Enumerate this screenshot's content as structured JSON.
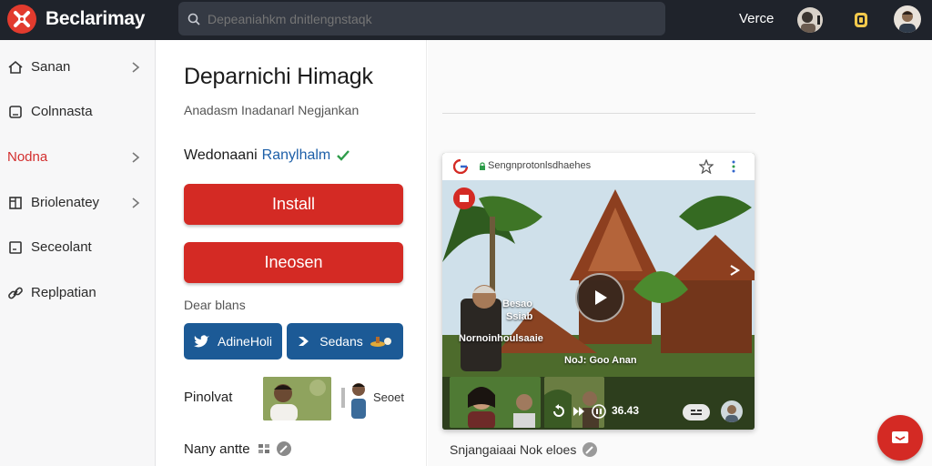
{
  "app": {
    "brand": "Beclarimay"
  },
  "search": {
    "placeholder": "Depeaniahkm dnitlengnstaqk"
  },
  "topbar": {
    "link": "Verce"
  },
  "sidebar": {
    "items": [
      {
        "label": "Sanan",
        "icon": "home-icon",
        "chevron": true
      },
      {
        "label": "Colnnasta",
        "icon": "square-icon",
        "chevron": false
      },
      {
        "label": "Nodna",
        "icon": "none",
        "chevron": true,
        "active": true
      },
      {
        "label": "Briolenatey",
        "icon": "columns-icon",
        "chevron": true
      },
      {
        "label": "Seceolant",
        "icon": "box-icon",
        "chevron": false
      },
      {
        "label": "Replpatian",
        "icon": "link-icon",
        "chevron": false
      }
    ]
  },
  "main": {
    "title": "Deparnichi Himagk",
    "subtitle": "Anadasm Inadanarl Negjankan",
    "developer_label": "Wedonaani",
    "developer_link": "Ranylhalm",
    "install_label": "Install",
    "secondary_label": "Ineosen",
    "share_label": "Dear blans",
    "share_twitter_label": "AdineHoli",
    "share_other_label": "Sedans",
    "profile_label": "Pinolvat",
    "profile_thumb_text": "Seoet",
    "many_label": "Nany antte"
  },
  "preview": {
    "url": "Sengnprotonlsdhaehes",
    "overlay_line1": "Besao",
    "overlay_line2": "Ssiab",
    "overlay_line3": "Nornoinhoulsaaie",
    "overlay_line4": "NoJ: Goo Anan",
    "time": "36.43",
    "caption": "Snjangaiaai Nok eloes"
  },
  "colors": {
    "brand_red": "#d42a24",
    "topbar": "#1f232b",
    "share_blue": "#1c5a96",
    "link_blue": "#1d5fa8"
  }
}
